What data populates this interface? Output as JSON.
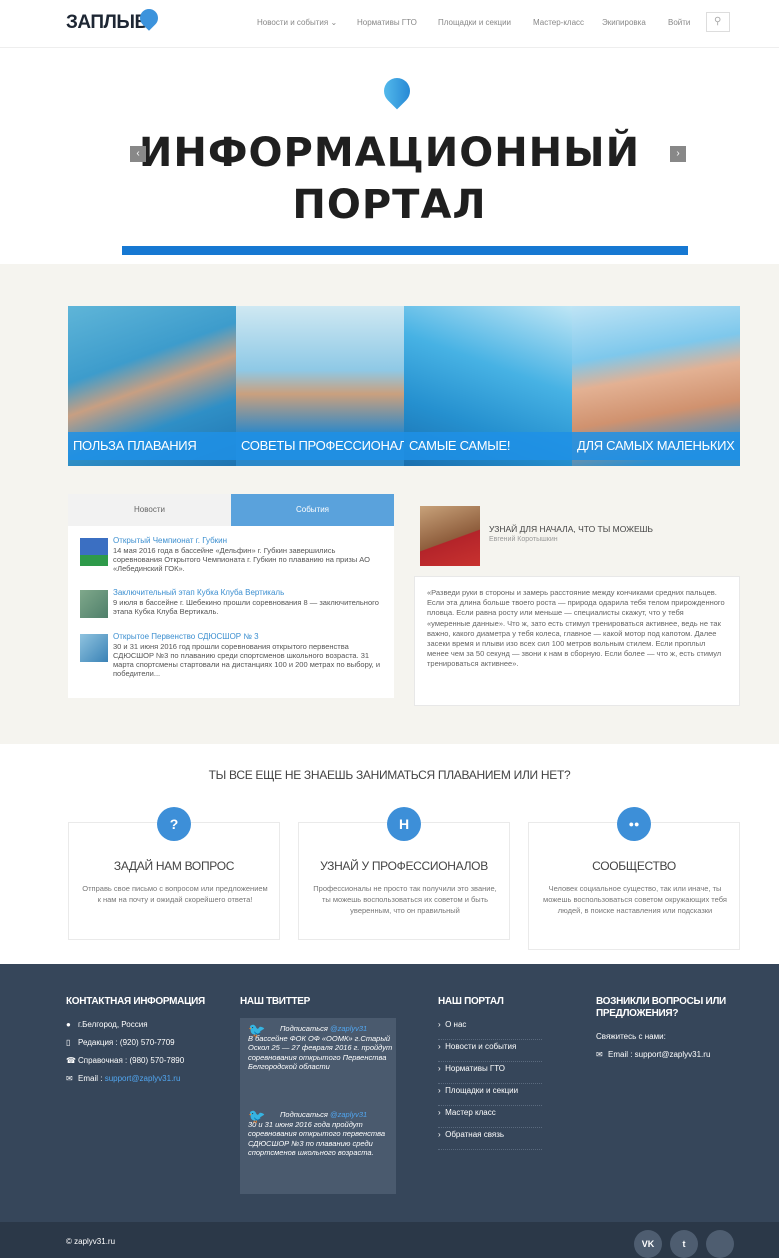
{
  "header": {
    "logo_text": "ЗАПЛЫВ",
    "nav": [
      "Новости и события ⌄",
      "Нормативы ГТО",
      "Площадки и секции",
      "Мастер-класс",
      "Экипировка",
      "Войти"
    ]
  },
  "hero": {
    "title_line1": "ИНФОРМАЦИОННЫЙ",
    "title_line2": "ПОРТАЛ",
    "prev": "‹",
    "next": "›"
  },
  "tiles": [
    {
      "label": "ПОЛЬЗА ПЛАВАНИЯ"
    },
    {
      "label": "СОВЕТЫ ПРОФЕССИОНАЛОВ"
    },
    {
      "label": "САМЫЕ САМЫЕ!"
    },
    {
      "label": "ДЛЯ САМЫХ МАЛЕНЬКИХ"
    }
  ],
  "news": {
    "tabs": [
      "Новости",
      "События"
    ],
    "items": [
      {
        "title": "Открытый Чемпионат г. Губкин",
        "text": "14 мая 2016 года в бассейне «Дельфин» г. Губкин завершились соревнования Открытого Чемпионата г. Губкин по плаванию на призы АО «Лебединский ГОК»."
      },
      {
        "title": "Заключительный этап Кубка Клуба Вертикаль",
        "text": "9 июля в бассейне г. Шебекино прошли соревнования 8 — заключительного этапа Кубка Клуба Вертикаль."
      },
      {
        "title": "Открытое Первенство СДЮСШОР № 3",
        "text": "30 и 31 июня 2016 год прошли соревнования открытого первенства СДЮСШОР №3 по плаванию среди спортсменов школьного возраста. 31 марта спортсмены стартовали на дистанциях 100 и 200 метрах по выбору, и победители..."
      }
    ]
  },
  "quote": {
    "title": "УЗНАЙ ДЛЯ НАЧАЛА, ЧТО ТЫ МОЖЕШЬ",
    "author": "Евгений Коротышкин",
    "text": "«Разведи руки в стороны и замерь расстояние между кончиками средних пальцев. Если эта длина больше твоего роста — природа одарила тебя телом прирожденного пловца. Если равна росту или меньше — специалисты скажут, что у тебя «умеренные данные». Что ж, зато есть стимул тренироваться активнее, ведь не так важно, какого диаметра у тебя колеса, главное — какой мотор под капотом. Далее засеки время и плыви изо всех сил 100 метров вольным стилем. Если проплыл менее чем за 50 секунд — звони к нам в сборную. Если более — что ж, есть стимул тренироваться активнее»."
  },
  "questions": {
    "heading": "ТЫ ВСЕ ЕЩЕ НЕ ЗНАЕШЬ ЗАНИМАТЬСЯ ПЛАВАНИЕМ ИЛИ НЕТ?",
    "cards": [
      {
        "icon": "?",
        "title": "ЗАДАЙ НАМ ВОПРОС",
        "text": "Отправь свое письмо с вопросом или предложением к нам на почту и ожидай скорейшего ответа!"
      },
      {
        "icon": "H",
        "title": "УЗНАЙ У ПРОФЕССИОНАЛОВ",
        "text": "Профессионалы не просто так получили это звание, ты можешь воспользоваться их советом и быть уверенным, что он правильный"
      },
      {
        "icon": "●●",
        "title": "СООБЩЕСТВО",
        "text": "Человек социальное существо, так или иначе, ты можешь воспользоваться советом окружающих тебя людей, в поиске наставления или подсказки"
      }
    ]
  },
  "footer": {
    "contact_head": "КОНТАКТНАЯ ИНФОРМАЦИЯ",
    "address": "г.Белгород, Россия",
    "editorial": "Редакция : (920) 570-7709",
    "help": "Справочная : (980) 570-7890",
    "email_label": "Email :",
    "email": "support@zaplyv31.ru",
    "twitter_head": "НАШ ТВИТТЕР",
    "tweets": [
      {
        "pre": "Подписаться",
        "handle": "@zaplyv31",
        "text": "В бассейне ФОК ОФ «ООМК» г.Старый Оскол 25 — 27 февраля 2016 г. пройдут соревнования открытого Первенства Белгородской области"
      },
      {
        "pre": "Подписаться",
        "handle": "@zaplyv31",
        "text": "30 и 31 июня 2016 года пройдут соревнования открытого первенства СДЮСШОР №3 по плаванию среди спортсменов школьного возраста."
      }
    ],
    "portal_head": "НАШ ПОРТАЛ",
    "portal_links": [
      "О нас",
      "Новости и события",
      "Нормативы ГТО",
      "Площадки и секции",
      "Мастер класс",
      "Обратная связь"
    ],
    "questions_head_1": "ВОЗНИКЛИ ВОПРОСЫ ИЛИ",
    "questions_head_2": "ПРЕДЛОЖЕНИЯ?",
    "contact_us": "Свяжитесь с нами:",
    "email_line": "Email : support@zaplyv31.ru",
    "copyright": "© zaplyv31.ru",
    "social": [
      "VK",
      "t",
      ""
    ]
  }
}
